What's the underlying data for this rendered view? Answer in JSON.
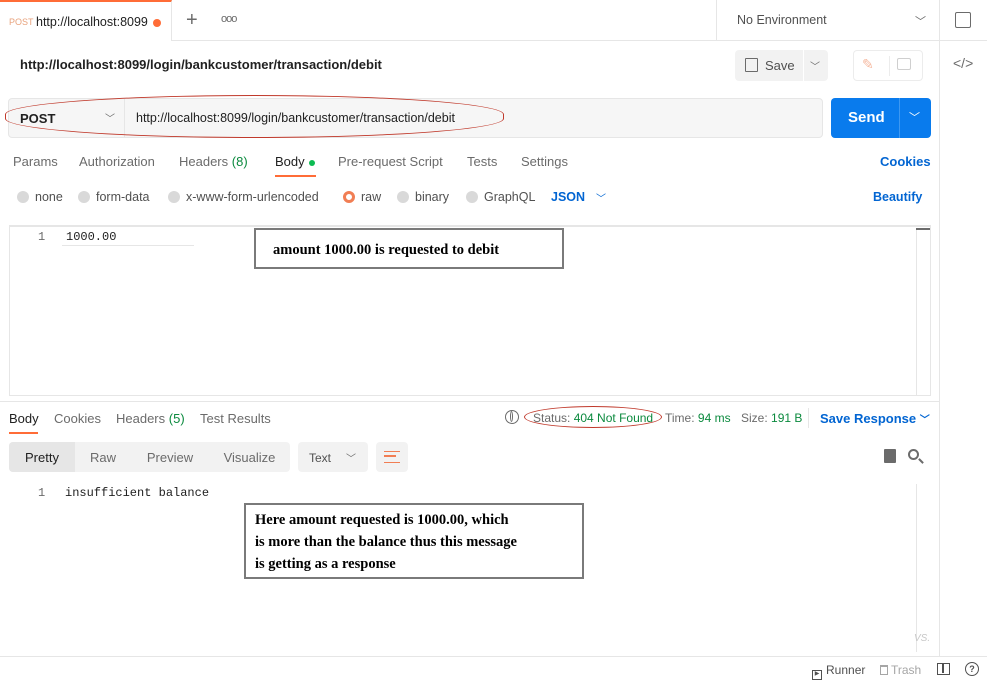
{
  "tab": {
    "method": "POST",
    "title": "http://localhost:8099/",
    "new_tab_icon": "plus-icon",
    "more_icon": "ellipsis-icon"
  },
  "environment": {
    "label": "No Environment"
  },
  "request": {
    "name": "http://localhost:8099/login/bankcustomer/transaction/debit",
    "method": "POST",
    "url": "http://localhost:8099/login/bankcustomer/transaction/debit",
    "save_label": "Save",
    "send_label": "Send"
  },
  "request_tabs": [
    {
      "label": "Params"
    },
    {
      "label": "Authorization"
    },
    {
      "label": "Headers",
      "count": "(8)"
    },
    {
      "label": "Body"
    },
    {
      "label": "Pre-request Script"
    },
    {
      "label": "Tests"
    },
    {
      "label": "Settings"
    }
  ],
  "cookies_link": "Cookies",
  "body_types": [
    {
      "label": "none"
    },
    {
      "label": "form-data"
    },
    {
      "label": "x-www-form-urlencoded"
    },
    {
      "label": "raw",
      "selected": true
    },
    {
      "label": "binary"
    },
    {
      "label": "GraphQL"
    }
  ],
  "raw_format": "JSON",
  "beautify_label": "Beautify",
  "editor": {
    "line_no": "1",
    "content": "1000.00"
  },
  "annotations": {
    "note1": "amount 1000.00 is requested to debit",
    "note2_lines": [
      "Here amount requested is 1000.00, which",
      "is more than the balance thus this message",
      "is getting as a response"
    ]
  },
  "response": {
    "tabs": [
      {
        "label": "Body"
      },
      {
        "label": "Cookies"
      },
      {
        "label": "Headers",
        "count": "(5)"
      },
      {
        "label": "Test Results"
      }
    ],
    "status_label": "Status:",
    "status_value": "404 Not Found",
    "time_label": "Time:",
    "time_value": "94 ms",
    "size_label": "Size:",
    "size_value": "191 B",
    "save_label": "Save Response",
    "views": [
      "Pretty",
      "Raw",
      "Preview",
      "Visualize"
    ],
    "format": "Text",
    "line_no": "1",
    "content": "insufficient balance",
    "watermark": "VS."
  },
  "statusbar": {
    "runner": "Runner",
    "trash": "Trash"
  },
  "colors": {
    "accent": "#ff6c37",
    "send_blue": "#097bed",
    "link_blue": "#0265d2",
    "status_green": "#0b8a3e",
    "annotation_red": "#c0392b"
  }
}
